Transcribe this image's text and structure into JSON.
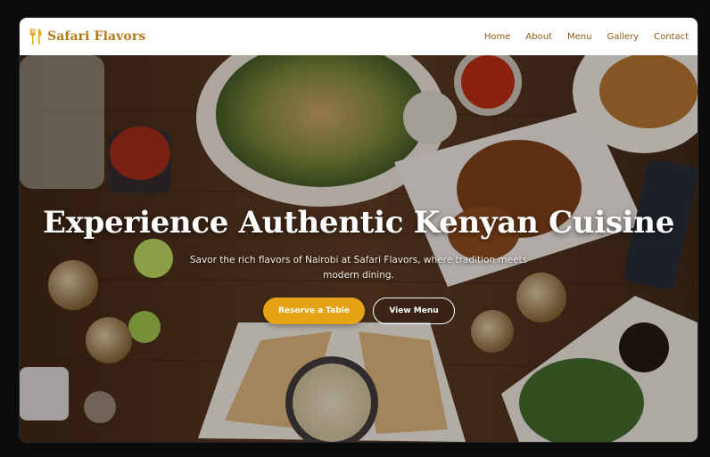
{
  "brand": {
    "name": "Safari Flavors",
    "icon": "fork-knife-icon",
    "color": "#b47a16"
  },
  "nav": {
    "items": [
      {
        "label": "Home"
      },
      {
        "label": "About"
      },
      {
        "label": "Menu"
      },
      {
        "label": "Gallery"
      },
      {
        "label": "Contact"
      }
    ]
  },
  "hero": {
    "title": "Experience Authentic Kenyan Cuisine",
    "subtitle": "Savor the rich flavors of Nairobi at Safari Flavors, where tradition meets modern dining.",
    "primary_button": "Reserve a Table",
    "secondary_button": "View Menu",
    "accent_color": "#e4a414"
  }
}
